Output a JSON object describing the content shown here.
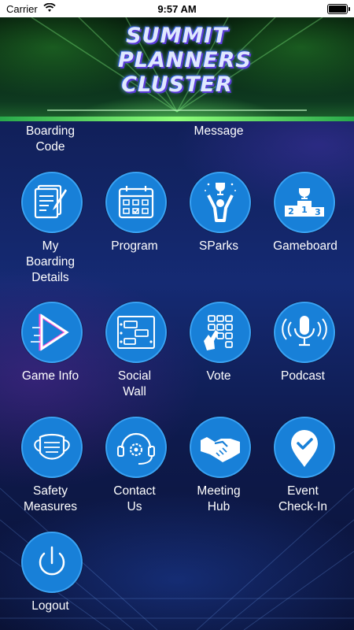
{
  "status_bar": {
    "carrier": "Carrier",
    "time": "9:57 AM"
  },
  "banner": {
    "logo_lines": [
      "SUMMIT",
      "PLANNERS",
      "CLUSTER"
    ]
  },
  "top_row": {
    "boarding_code_label": "Boarding\nCode",
    "message_label": "Message"
  },
  "menu": [
    {
      "label": "My\nBoarding\nDetails",
      "icon": "document-edit-icon"
    },
    {
      "label": "Program",
      "icon": "calendar-icon"
    },
    {
      "label": "SParks",
      "icon": "trophy-person-icon"
    },
    {
      "label": "Gameboard",
      "icon": "podium-icon"
    },
    {
      "label": "Game Info",
      "icon": "play-glitch-icon"
    },
    {
      "label": "Social\nWall",
      "icon": "social-wall-icon"
    },
    {
      "label": "Vote",
      "icon": "vote-keypad-icon"
    },
    {
      "label": "Podcast",
      "icon": "podcast-mic-icon"
    },
    {
      "label": "Safety\nMeasures",
      "icon": "face-mask-icon"
    },
    {
      "label": "Contact\nUs",
      "icon": "headset-gear-icon"
    },
    {
      "label": "Meeting\nHub",
      "icon": "handshake-icon"
    },
    {
      "label": "Event\nCheck-In",
      "icon": "location-check-icon"
    },
    {
      "label": "Logout",
      "icon": "power-icon"
    }
  ],
  "colors": {
    "icon_fill": "#1880d8",
    "icon_border": "#3aa2f4",
    "background": "#11205a",
    "label_text": "#ffffff"
  }
}
